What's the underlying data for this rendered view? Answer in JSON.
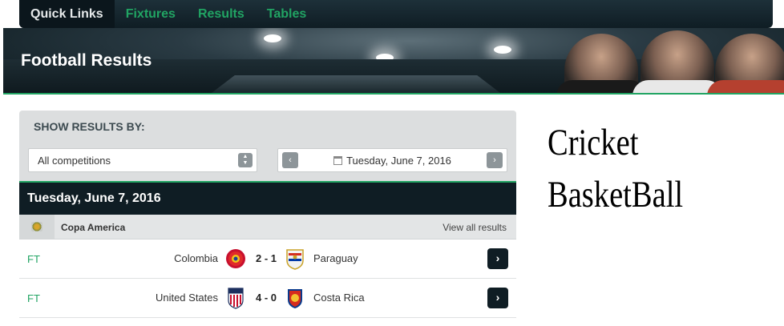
{
  "nav": {
    "items": [
      {
        "label": "Quick Links",
        "active": true
      },
      {
        "label": "Fixtures",
        "active": false
      },
      {
        "label": "Results",
        "active": false
      },
      {
        "label": "Tables",
        "active": false
      }
    ]
  },
  "banner": {
    "title": "Football Results"
  },
  "filter": {
    "title": "SHOW RESULTS BY:",
    "competition_value": "All competitions",
    "date_value": "Tuesday,  June 7,  2016"
  },
  "day": {
    "header": "Tuesday, June 7, 2016",
    "competition": {
      "name": "Copa America",
      "view_all": "View all results"
    },
    "matches": [
      {
        "status": "FT",
        "home": "Colombia",
        "score": "2 - 1",
        "away": "Paraguay"
      },
      {
        "status": "FT",
        "home": "United States",
        "score": "4 - 0",
        "away": "Costa Rica"
      }
    ]
  },
  "side_links": [
    "Cricket",
    "BasketBall"
  ],
  "colors": {
    "accent": "#21a463",
    "dark": "#0f1d24",
    "panel": "#dcdedf"
  },
  "icons": [
    "calendar-icon",
    "up-down-arrows-icon",
    "chevron-left-icon",
    "chevron-right-icon",
    "copa-america-logo-icon"
  ]
}
